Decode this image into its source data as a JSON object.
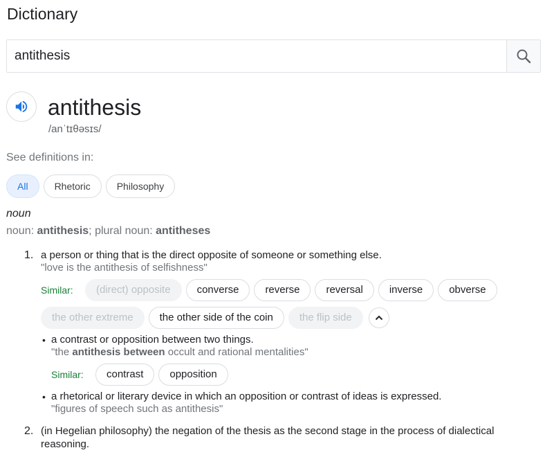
{
  "header": {
    "title": "Dictionary"
  },
  "search": {
    "query": "antithesis",
    "icon": "search-icon"
  },
  "entry": {
    "word": "antithesis",
    "phonetic": "/anˈtɪθəsɪs/",
    "see_definitions_label": "See definitions in:",
    "domains": [
      "All",
      "Rhetoric",
      "Philosophy"
    ],
    "part_of_speech": "noun",
    "forms": {
      "prefix": "noun: ",
      "singular": "antithesis",
      "sep": "; plural noun: ",
      "plural": "antitheses"
    },
    "senses": [
      {
        "number": "1.",
        "definition": "a person or thing that is the direct opposite of someone or something else.",
        "example": "\"love is the antithesis of selfishness\"",
        "similar_label": "Similar:",
        "synonyms_row1": [
          {
            "text": "(direct) opposite",
            "faded": true
          },
          {
            "text": "converse",
            "faded": false
          },
          {
            "text": "reverse",
            "faded": false
          },
          {
            "text": "reversal",
            "faded": false
          },
          {
            "text": "inverse",
            "faded": false
          },
          {
            "text": "obverse",
            "faded": false
          }
        ],
        "synonyms_row2": [
          {
            "text": "the other extreme",
            "faded": true
          },
          {
            "text": "the other side of the coin",
            "faded": false
          },
          {
            "text": "the flip side",
            "faded": true
          }
        ],
        "subsenses": [
          {
            "definition": "a contrast or opposition between two things.",
            "example_pre": "\"the ",
            "example_bold": "antithesis between",
            "example_post": " occult and rational mentalities\"",
            "similar_label": "Similar:",
            "synonyms": [
              "contrast",
              "opposition"
            ]
          },
          {
            "definition": "a rhetorical or literary device in which an opposition or contrast of ideas is expressed.",
            "example": "\"figures of speech such as antithesis\""
          }
        ]
      },
      {
        "number": "2.",
        "definition_line1": "(in Hegelian philosophy) the negation of the thesis as the second stage in the process of dialectical",
        "definition_line2": "reasoning."
      }
    ]
  },
  "colors": {
    "accent": "#1a73e8",
    "similar_green": "#188038",
    "muted": "#70757a"
  }
}
